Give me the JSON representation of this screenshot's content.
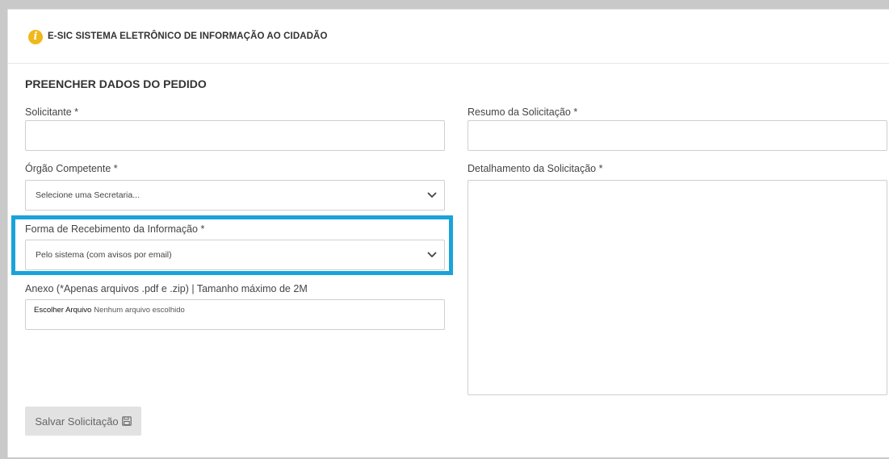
{
  "header": {
    "icon": "info-icon",
    "icon_color": "#f0b81b",
    "title": "E-SIC SISTEMA ELETRÔNICO DE INFORMAÇÃO AO CIDADÃO"
  },
  "form": {
    "section_title": "PREENCHER DADOS DO PEDIDO",
    "solicitante": {
      "label": "Solicitante *",
      "value": ""
    },
    "orgao": {
      "label": "Órgão Competente *",
      "selected": "Selecione uma Secretaria..."
    },
    "forma_recebimento": {
      "label": "Forma de Recebimento da Informação *",
      "selected": "Pelo sistema (com avisos por email)"
    },
    "anexo": {
      "label": "Anexo (*Apenas arquivos .pdf e .zip) | Tamanho máximo de 2M",
      "button_label": "Escolher Arquivo",
      "status": "Nenhum arquivo escolhido"
    },
    "resumo": {
      "label": "Resumo da Solicitação *",
      "value": ""
    },
    "detalhamento": {
      "label": "Detalhamento da Solicitação *",
      "value": ""
    },
    "save_label": "Salvar Solicitação"
  },
  "colors": {
    "highlight": "#1aa3d9",
    "button_bg": "#e2e2e2"
  }
}
